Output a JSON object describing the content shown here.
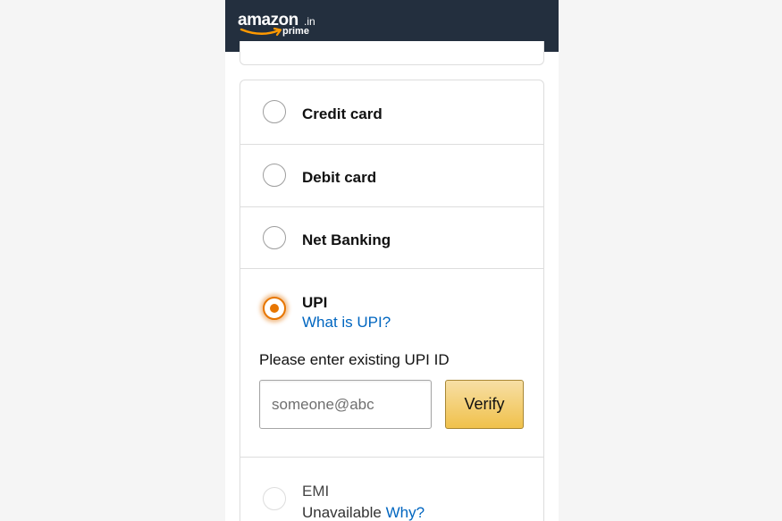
{
  "header": {
    "logo_main": "amazon",
    "logo_tld": ".in",
    "logo_sub": "prime"
  },
  "payment_methods": {
    "credit_card": {
      "label": "Credit card",
      "selected": false
    },
    "debit_card": {
      "label": "Debit card",
      "selected": false
    },
    "net_banking": {
      "label": "Net Banking",
      "selected": false
    },
    "upi": {
      "label": "UPI",
      "selected": true,
      "help_link": "What is UPI?",
      "prompt": "Please enter existing UPI ID",
      "input_placeholder": "someone@abc",
      "input_value": "",
      "verify_label": "Verify"
    },
    "emi": {
      "label": "EMI",
      "selected": false,
      "status": "Unavailable",
      "why_link": "Why?"
    }
  },
  "colors": {
    "header_bg": "#232f3e",
    "selected_accent": "#e77600",
    "link": "#0066c0",
    "button_yellow": "#f0c14b"
  }
}
